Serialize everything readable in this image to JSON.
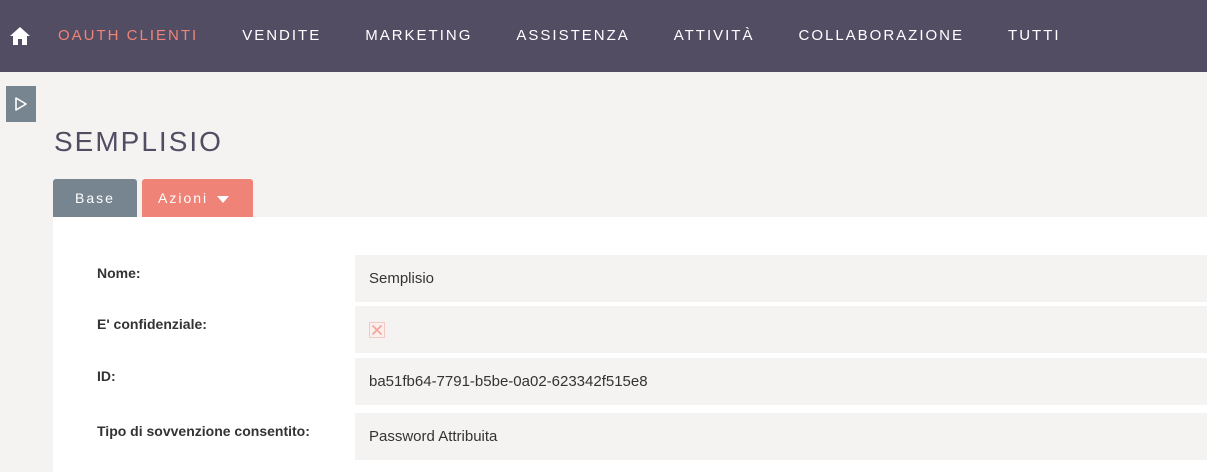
{
  "nav": {
    "items": [
      {
        "label": "OAUTH CLIENTI",
        "active": true
      },
      {
        "label": "VENDITE",
        "active": false
      },
      {
        "label": "MARKETING",
        "active": false
      },
      {
        "label": "ASSISTENZA",
        "active": false
      },
      {
        "label": "ATTIVITÀ",
        "active": false
      },
      {
        "label": "COLLABORAZIONE",
        "active": false
      },
      {
        "label": "TUTTI",
        "active": false
      }
    ]
  },
  "page": {
    "title": "SEMPLISIO"
  },
  "tabs": {
    "base": "Base",
    "azioni": "Azioni"
  },
  "fields": {
    "nome": {
      "label": "Nome:",
      "value": "Semplisio"
    },
    "confidenziale": {
      "label": "E' confidenziale:",
      "checked": false
    },
    "id": {
      "label": "ID:",
      "value": "ba51fb64-7791-b5be-0a02-623342f515e8"
    },
    "tipo": {
      "label": "Tipo di sovvenzione consentito:",
      "value": "Password Attribuita"
    }
  },
  "colors": {
    "topbar": "#534d64",
    "accent": "#f08377",
    "tab_base": "#778591"
  },
  "icons": {
    "home": "home-icon",
    "sidebar_toggle": "play-outline-icon",
    "dropdown": "caret-down-icon",
    "checkbox_unchecked": "x-mark-icon"
  }
}
